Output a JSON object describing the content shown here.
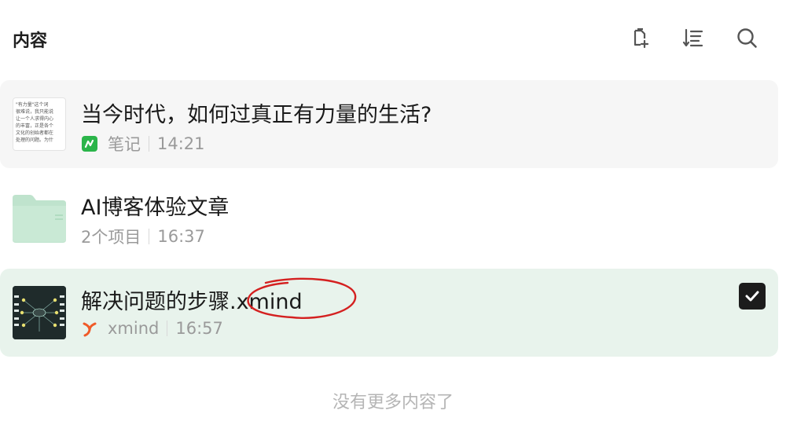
{
  "header": {
    "title": "内容",
    "actions": [
      {
        "name": "new-page-icon"
      },
      {
        "name": "sort-icon"
      },
      {
        "name": "search-icon"
      }
    ]
  },
  "items": [
    {
      "title": "当今时代，如何过真正有力量的生活?",
      "source_icon": "note-app-icon",
      "source_label": "笔记",
      "time": "14:21",
      "thumbnail_lines": [
        "\"有力量\"这个词",
        "很难说，我只能说",
        "让一个人求得内心",
        "的丰富，正是各个",
        "文化的创始者都在",
        "处理的问题。为什"
      ],
      "selected": false
    },
    {
      "title": "AI博客体验文章",
      "source_label": "2个项目",
      "time": "16:37",
      "type": "folder",
      "selected": false
    },
    {
      "title": "解决问题的步骤.xmind",
      "source_icon": "xmind-icon",
      "source_label": "xmind",
      "time": "16:57",
      "selected": true
    }
  ],
  "footer": {
    "text": "没有更多内容了"
  },
  "colors": {
    "selected_row_bg": "#e8f3ec",
    "note_icon": "#2bb54a",
    "xmind_icon": "#f05a28",
    "annotation": "#d42020",
    "folder": "#bfe3cd"
  }
}
